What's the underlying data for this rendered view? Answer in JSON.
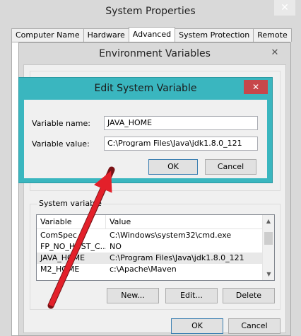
{
  "system_properties": {
    "title": "System Properties",
    "tabs": [
      {
        "label": "Computer Name"
      },
      {
        "label": "Hardware"
      },
      {
        "label": "Advanced"
      },
      {
        "label": "System Protection"
      },
      {
        "label": "Remote"
      }
    ],
    "active_tab": "Advanced"
  },
  "env_vars": {
    "title": "Environment Variables",
    "system_group_label": "System variable",
    "columns": {
      "variable": "Variable",
      "value": "Value"
    },
    "rows": [
      {
        "name": "ComSpec",
        "value": "C:\\Windows\\system32\\cmd.exe"
      },
      {
        "name": "FP_NO_HOST_C...",
        "value": "NO"
      },
      {
        "name": "JAVA_HOME",
        "value": "C:\\Program Files\\Java\\jdk1.8.0_121"
      },
      {
        "name": "M2_HOME",
        "value": "c:\\Apache\\Maven"
      }
    ],
    "selected_row": 2,
    "buttons": {
      "new": "New...",
      "edit": "Edit...",
      "delete": "Delete"
    },
    "footer": {
      "ok": "OK",
      "cancel": "Cancel"
    }
  },
  "edit_dialog": {
    "title": "Edit System Variable",
    "name_label": "Variable name:",
    "name_value": "JAVA_HOME",
    "value_label": "Variable value:",
    "value_value": "C:\\Program Files\\Java\\jdk1.8.0_121",
    "ok": "OK",
    "cancel": "Cancel"
  },
  "colors": {
    "dialog_frame": "#3ab6bf",
    "close_button": "#c7474b",
    "arrow": "#e3202a"
  },
  "icons": {
    "close": "close-icon",
    "scroll_up": "chevron-up-icon",
    "scroll_down": "chevron-down-icon"
  }
}
